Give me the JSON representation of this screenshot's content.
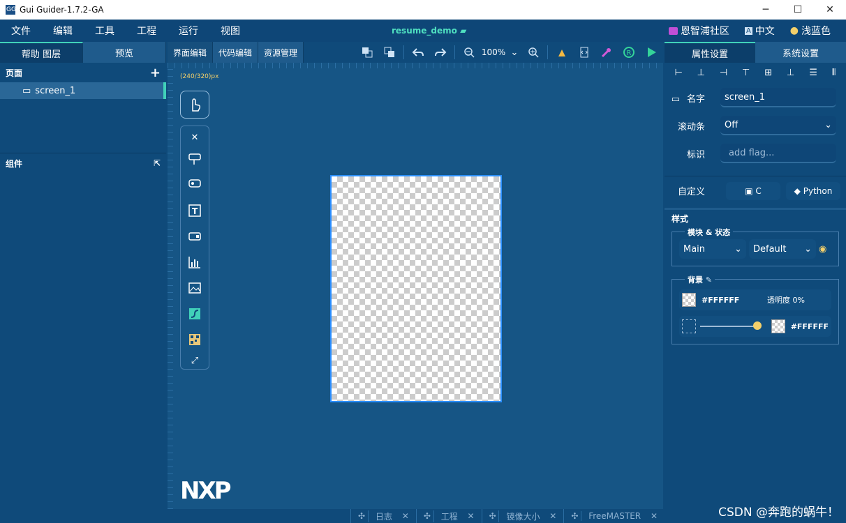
{
  "window": {
    "title": "Gui Guider-1.7.2-GA",
    "app_icon": "GG",
    "minimize": "─",
    "maximize": "☐",
    "close": "✕"
  },
  "menu": [
    "文件",
    "编辑",
    "工具",
    "工程",
    "运行",
    "视图"
  ],
  "project_name": "resume_demo",
  "right_menu": {
    "community": "恩智浦社区",
    "language": "中文",
    "theme": "浅蓝色",
    "lang_icon": "A"
  },
  "left_tabs": {
    "help": "帮助",
    "layers": "图层",
    "preview": "预览"
  },
  "center_tabs": [
    "界面编辑",
    "代码编辑",
    "资源管理"
  ],
  "zoom": "100%",
  "pages": {
    "header": "页面",
    "add": "+",
    "items": [
      "screen_1"
    ]
  },
  "components": {
    "header": "组件"
  },
  "canvas": {
    "size_label": "(240/320)px",
    "logo": "NXP"
  },
  "bottom": [
    "日志",
    "工程",
    "镜像大小",
    "FreeMASTER"
  ],
  "right_tabs": [
    "属性设置",
    "系统设置"
  ],
  "props": {
    "name_label": "名字",
    "name_value": "screen_1",
    "scroll_label": "滚动条",
    "scroll_value": "Off",
    "flag_label": "标识",
    "flag_placeholder": "add flag...",
    "custom_label": "自定义",
    "c_label": "C",
    "python_label": "Python"
  },
  "style": {
    "header": "样式",
    "module_state": "模块 & 状态",
    "main": "Main",
    "default": "Default",
    "background": "背景",
    "color1": "#FFFFFF",
    "opacity": "透明度 0%",
    "color2": "#FFFFFF"
  },
  "colors": {
    "bg": "#0f4a7a",
    "accent": "#41d1b9",
    "project": "#4fe0c0",
    "play": "#34d399"
  },
  "watermark": "CSDN @奔跑的蜗牛！"
}
